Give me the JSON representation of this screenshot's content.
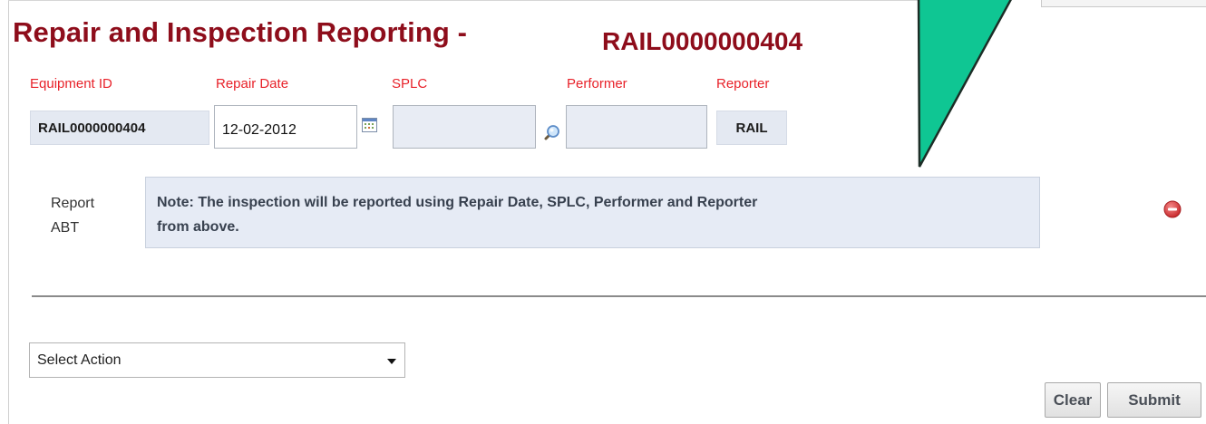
{
  "header": {
    "title": "Repair and Inspection Reporting - ",
    "equipment_id": "RAIL0000000404"
  },
  "fields": {
    "equipment_id": {
      "label": "Equipment ID",
      "value": "RAIL0000000404"
    },
    "repair_date": {
      "label": "Repair Date",
      "value": "12-02-2012",
      "icon": "calendar-icon"
    },
    "splc": {
      "label": "SPLC",
      "value": "",
      "icon": "search-icon"
    },
    "performer": {
      "label": "Performer",
      "value": ""
    },
    "reporter": {
      "label": "Reporter",
      "value": "RAIL"
    }
  },
  "report": {
    "label_line1": "Report",
    "label_line2": "ABT",
    "note_line1": "Note: The inspection will be reported using Repair Date, SPLC, Performer and Reporter",
    "note_line2": "from above.",
    "remove_icon": "remove-circle-icon"
  },
  "actions": {
    "select_action": "Select Action",
    "clear_label": "Clear",
    "submit_label": "Submit"
  },
  "colors": {
    "title": "#8e0d1b",
    "field_label": "#e8222a",
    "note_background": "#e6ebf5",
    "callout_arrow": "#0fc693",
    "remove_icon": "#d9373a"
  }
}
